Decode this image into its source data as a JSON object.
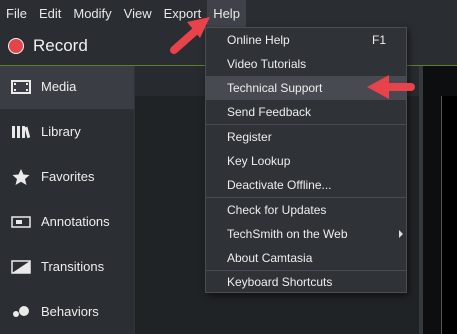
{
  "menubar": {
    "items": [
      {
        "label": "File"
      },
      {
        "label": "Edit"
      },
      {
        "label": "Modify"
      },
      {
        "label": "View"
      },
      {
        "label": "Export"
      },
      {
        "label": "Help"
      }
    ]
  },
  "record": {
    "label": "Record"
  },
  "sidebar": {
    "items": [
      {
        "label": "Media",
        "icon": "film-icon"
      },
      {
        "label": "Library",
        "icon": "library-icon"
      },
      {
        "label": "Favorites",
        "icon": "star-icon"
      },
      {
        "label": "Annotations",
        "icon": "annotation-icon"
      },
      {
        "label": "Transitions",
        "icon": "transition-icon"
      },
      {
        "label": "Behaviors",
        "icon": "behaviors-icon"
      }
    ]
  },
  "help_menu": {
    "items": [
      {
        "label": "Online Help",
        "shortcut": "F1"
      },
      {
        "label": "Video Tutorials"
      },
      {
        "label": "Technical Support"
      },
      {
        "label": "Send Feedback"
      },
      {
        "label": "Register"
      },
      {
        "label": "Key Lookup"
      },
      {
        "label": "Deactivate Offline..."
      },
      {
        "label": "Check for Updates"
      },
      {
        "label": "TechSmith on the Web"
      },
      {
        "label": "About Camtasia"
      },
      {
        "label": "Keyboard Shortcuts"
      }
    ]
  },
  "colors": {
    "record_dot": "#e2454b",
    "annotation_arrow": "#e8424a",
    "highlight": "#474b51"
  }
}
